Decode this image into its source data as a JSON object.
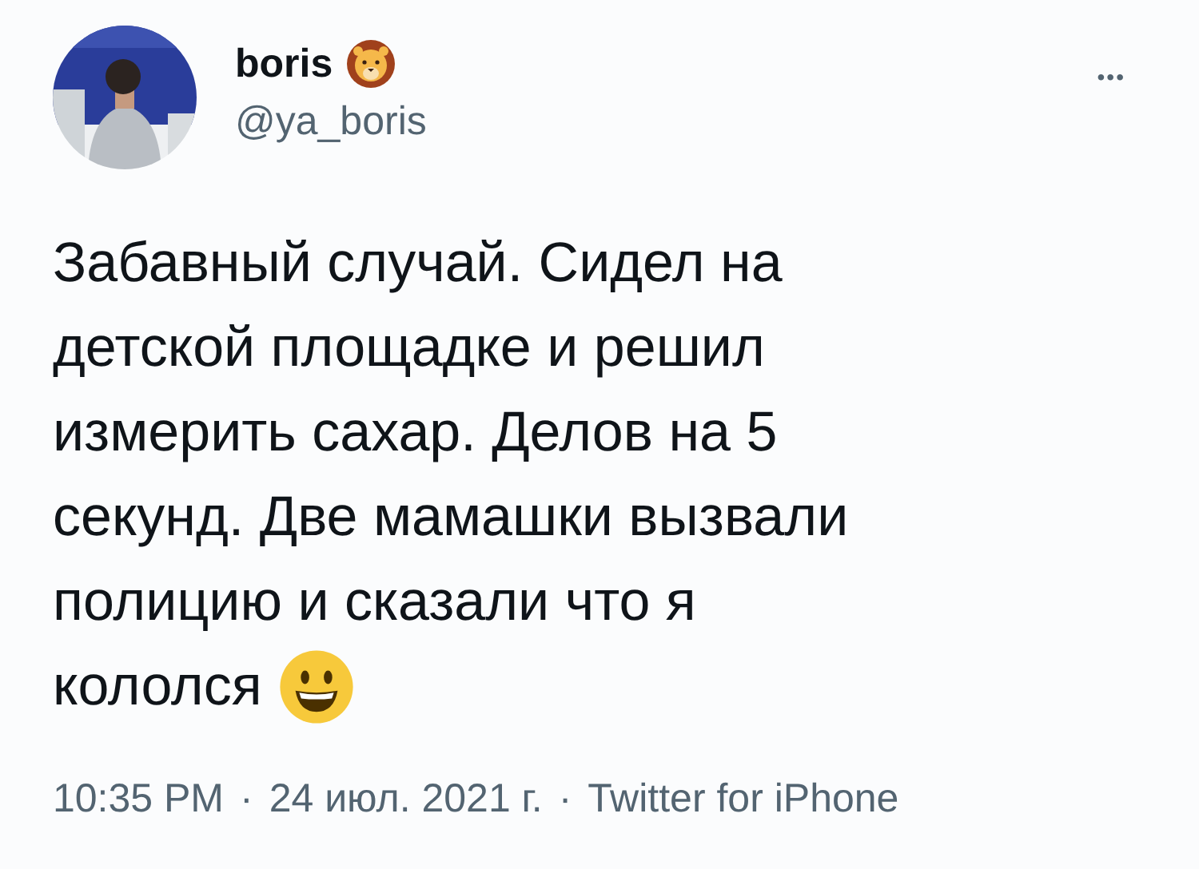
{
  "author": {
    "name": "boris",
    "handle": "@ya_boris"
  },
  "more": "•••",
  "text_lines": [
    "Забавный случай. Сидел на",
    "детской площадке и решил",
    "измерить сахар. Делов на 5",
    "секунд. Две мамашки вызвали",
    "полицию и сказали что я",
    "кололся"
  ],
  "meta": [
    {
      "kind": "time",
      "text": "10:35 PM"
    },
    {
      "kind": "sep",
      "text": "·"
    },
    {
      "kind": "date",
      "text": "24 июл. 2021 г."
    },
    {
      "kind": "sep",
      "text": "·"
    },
    {
      "kind": "source",
      "text": "Twitter for iPhone"
    }
  ]
}
